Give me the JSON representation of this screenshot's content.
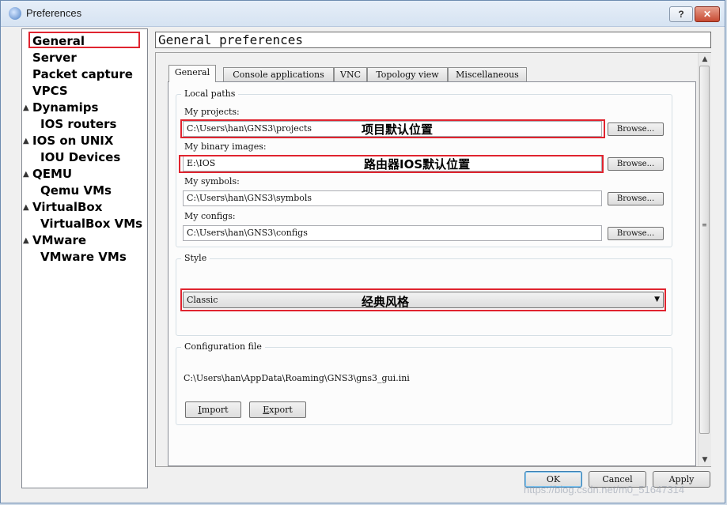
{
  "window": {
    "title": "Preferences",
    "help_label": "?",
    "close_label": "✕"
  },
  "sidebar": {
    "items": [
      {
        "label": "General"
      },
      {
        "label": "Server"
      },
      {
        "label": "Packet capture"
      },
      {
        "label": "VPCS"
      },
      {
        "label": "Dynamips"
      },
      {
        "label": "IOS routers"
      },
      {
        "label": "IOS on UNIX"
      },
      {
        "label": "IOU Devices"
      },
      {
        "label": "QEMU"
      },
      {
        "label": "Qemu VMs"
      },
      {
        "label": "VirtualBox"
      },
      {
        "label": "VirtualBox VMs"
      },
      {
        "label": "VMware"
      },
      {
        "label": "VMware VMs"
      }
    ]
  },
  "main": {
    "title": "General preferences",
    "tabs": [
      {
        "label": "General"
      },
      {
        "label": "Console applications"
      },
      {
        "label": "VNC"
      },
      {
        "label": "Topology view"
      },
      {
        "label": "Miscellaneous"
      }
    ],
    "local_paths": {
      "title": "Local paths",
      "projects_label": "My projects:",
      "projects_value": "C:\\Users\\han\\GNS3\\projects",
      "projects_note": "项目默认位置",
      "binary_label": "My binary images:",
      "binary_value": "E:\\IOS",
      "binary_note": "路由器IOS默认位置",
      "symbols_label": "My symbols:",
      "symbols_value": "C:\\Users\\han\\GNS3\\symbols",
      "configs_label": "My configs:",
      "configs_value": "C:\\Users\\han\\GNS3\\configs",
      "browse_label": "Browse..."
    },
    "style": {
      "title": "Style",
      "selected": "Classic",
      "note": "经典风格"
    },
    "config_file": {
      "title": "Configuration file",
      "path": "C:\\Users\\han\\AppData\\Roaming\\GNS3\\gns3_gui.ini",
      "import_label": "Import",
      "export_label": "Export"
    }
  },
  "buttons": {
    "ok": "OK",
    "cancel": "Cancel",
    "apply": "Apply"
  },
  "watermark": "https://blog.csdn.net/m0_51647314"
}
